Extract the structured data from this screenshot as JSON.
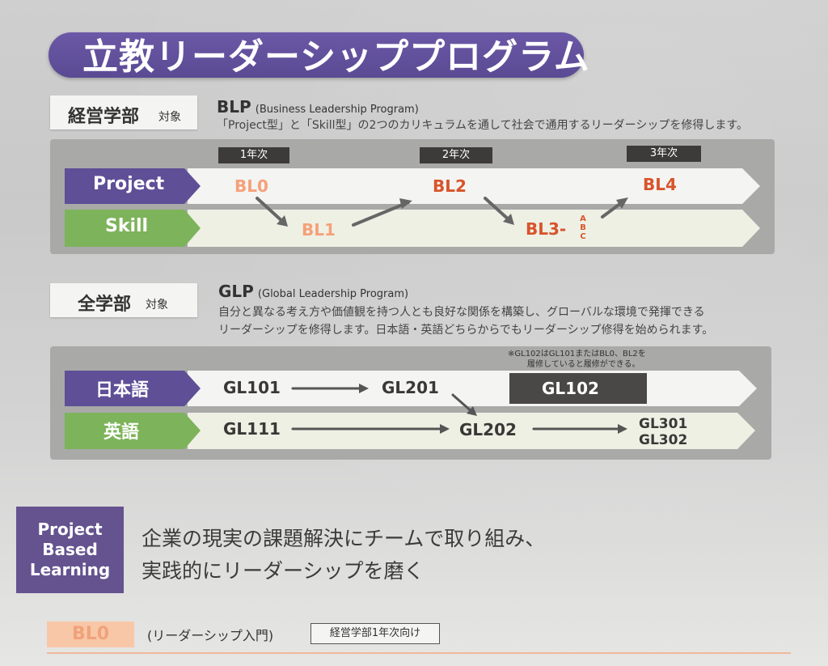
{
  "title": "立教リーダーシッププログラム",
  "blp": {
    "target_main": "経営学部",
    "target_suffix": "対象",
    "abbr": "BLP",
    "full": "(Business Leadership Program)",
    "description": "「Project型」と「Skill型」の2つのカリキュラムを通して社会で通用するリーダーシップを修得します。",
    "years": [
      "1年次",
      "2年次",
      "3年次"
    ],
    "tracks": [
      "Project",
      "Skill"
    ],
    "courses": {
      "bl0": "BL0",
      "bl1": "BL1",
      "bl2": "BL2",
      "bl3": "BL3-",
      "bl3_sub": [
        "A",
        "B",
        "C"
      ],
      "bl4": "BL4"
    }
  },
  "glp": {
    "target_main": "全学部",
    "target_suffix": "対象",
    "abbr": "GLP",
    "full": "(Global Leadership Program)",
    "description_lines": [
      "自分と異なる考え方や価値観を持つ人とも良好な関係を構築し、グローバルな環境で発揮できる",
      "リーダーシップを修得します。日本語・英語どちらからでもリーダーシップ修得を始められます。"
    ],
    "note_lines": [
      "※GL102はGL101またはBL0、BL2を",
      "履修していると履修ができる。"
    ],
    "tracks": [
      "日本語",
      "英語"
    ],
    "courses": {
      "gl101": "GL101",
      "gl201": "GL201",
      "gl102": "GL102",
      "gl111": "GL111",
      "gl202": "GL202",
      "gl301": "GL301",
      "gl302": "GL302"
    }
  },
  "pbl": {
    "label_lines": [
      "Project",
      "Based",
      "Learning"
    ],
    "tagline_lines": [
      "企業の現実の課題解決にチームで取り組み、",
      "実践的にリーダーシップを磨く"
    ]
  },
  "bl0_section": {
    "code": "BL0",
    "subtitle": "(リーダーシップ入門)",
    "badge": "経営学部1年次向け"
  },
  "colors": {
    "purple": "#5a4a93",
    "green": "#7db35a",
    "orange_red": "#d8542b",
    "light_orange": "#f5a17a"
  }
}
